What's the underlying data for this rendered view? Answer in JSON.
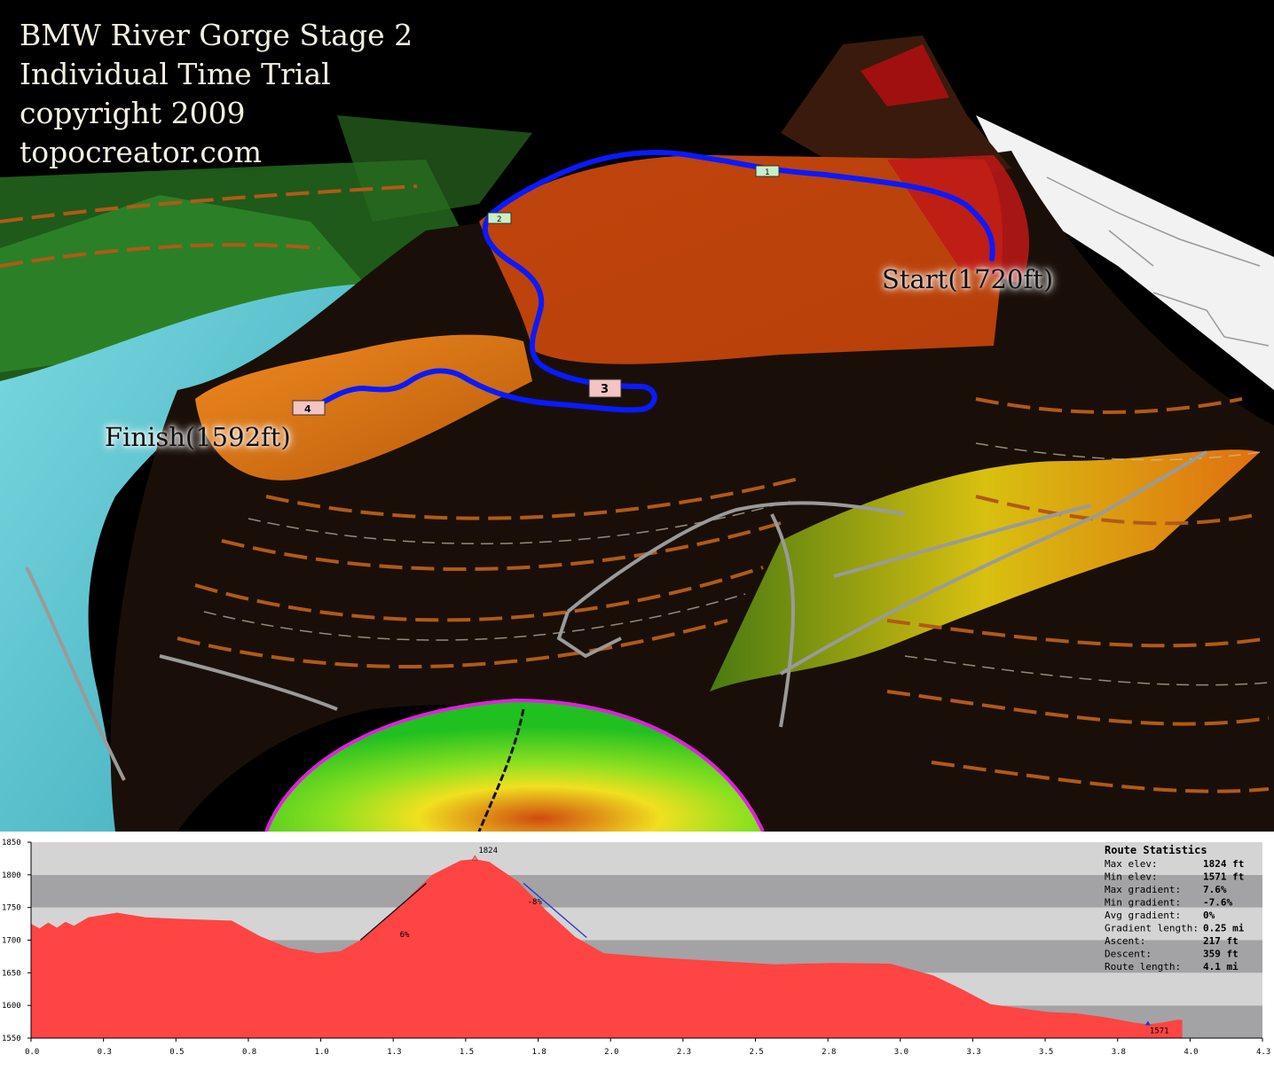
{
  "title_lines": [
    "BMW River Gorge Stage 2",
    "Individual Time Trial",
    "copyright 2009",
    "topocreator.com"
  ],
  "map_labels": {
    "start": "Start(1720ft)",
    "finish": "Finish(1592ft)"
  },
  "route_markers": [
    "1",
    "2",
    "3",
    "4"
  ],
  "colors": {
    "route": "#0a1aff",
    "profile_fill": "#ff4444",
    "band_dark": "#a3a3a5",
    "band_light": "#d4d4d4",
    "terrain_high": "#c04010",
    "river": "#5ec8d6"
  },
  "chart_data": {
    "type": "area",
    "title": "",
    "xlabel": "",
    "ylabel": "",
    "xlim": [
      0,
      4.3
    ],
    "ylim": [
      1550,
      1850
    ],
    "x_ticks": [
      "0.0",
      "0.3",
      "0.5",
      "0.8",
      "1.0",
      "1.3",
      "1.5",
      "1.8",
      "2.0",
      "2.3",
      "2.5",
      "2.8",
      "3.0",
      "3.3",
      "3.5",
      "3.8",
      "4.0",
      "4.3"
    ],
    "y_ticks": [
      "1550",
      "1600",
      "1650",
      "1700",
      "1750",
      "1800",
      "1850"
    ],
    "series": [
      {
        "x": [
          0.0,
          0.03,
          0.06,
          0.09,
          0.12,
          0.15,
          0.2,
          0.3,
          0.4,
          0.55,
          0.7,
          0.8,
          0.9,
          1.0,
          1.08,
          1.15,
          1.3,
          1.4,
          1.5,
          1.55,
          1.6,
          1.7,
          1.8,
          1.9,
          2.0,
          2.2,
          2.4,
          2.6,
          2.8,
          3.0,
          3.15,
          3.25,
          3.35,
          3.45,
          3.55,
          3.65,
          3.75,
          3.85,
          3.9,
          3.95,
          4.0,
          4.02
        ],
        "y": [
          1725,
          1718,
          1727,
          1719,
          1728,
          1722,
          1735,
          1742,
          1735,
          1732,
          1730,
          1706,
          1688,
          1680,
          1683,
          1700,
          1758,
          1800,
          1822,
          1824,
          1820,
          1790,
          1745,
          1705,
          1680,
          1673,
          1668,
          1663,
          1665,
          1664,
          1646,
          1625,
          1602,
          1596,
          1590,
          1588,
          1582,
          1574,
          1571,
          1574,
          1578,
          1578
        ]
      }
    ],
    "annotations": [
      {
        "label": "1824",
        "x": 1.55,
        "y": 1824
      },
      {
        "label": "1571",
        "x": 3.9,
        "y": 1571
      },
      {
        "label": "6%",
        "x": 1.3,
        "y": 1705
      },
      {
        "label": "-8%",
        "x": 1.74,
        "y": 1755
      }
    ],
    "gradient_segments": [
      {
        "label": "6%",
        "x1": 1.15,
        "y1": 1700,
        "x2": 1.38,
        "y2": 1787
      },
      {
        "label": "-8%",
        "x1": 1.72,
        "y1": 1787,
        "x2": 1.94,
        "y2": 1704
      }
    ],
    "grid_bands": true,
    "legend": "none"
  },
  "route_statistics": {
    "title": "Route Statistics",
    "rows": [
      {
        "label": "Max elev:",
        "value": "1824 ft"
      },
      {
        "label": "Min elev:",
        "value": "1571 ft"
      },
      {
        "label": "Max gradient:",
        "value": "7.6%"
      },
      {
        "label": "Min gradient:",
        "value": "-7.6%"
      },
      {
        "label": "Avg gradient:",
        "value": "0%"
      },
      {
        "label": "Gradient length:",
        "value": "0.25 mi"
      },
      {
        "label": "Ascent:",
        "value": "217 ft"
      },
      {
        "label": "Descent:",
        "value": "359 ft"
      },
      {
        "label": "Route length:",
        "value": "4.1 mi"
      }
    ]
  }
}
